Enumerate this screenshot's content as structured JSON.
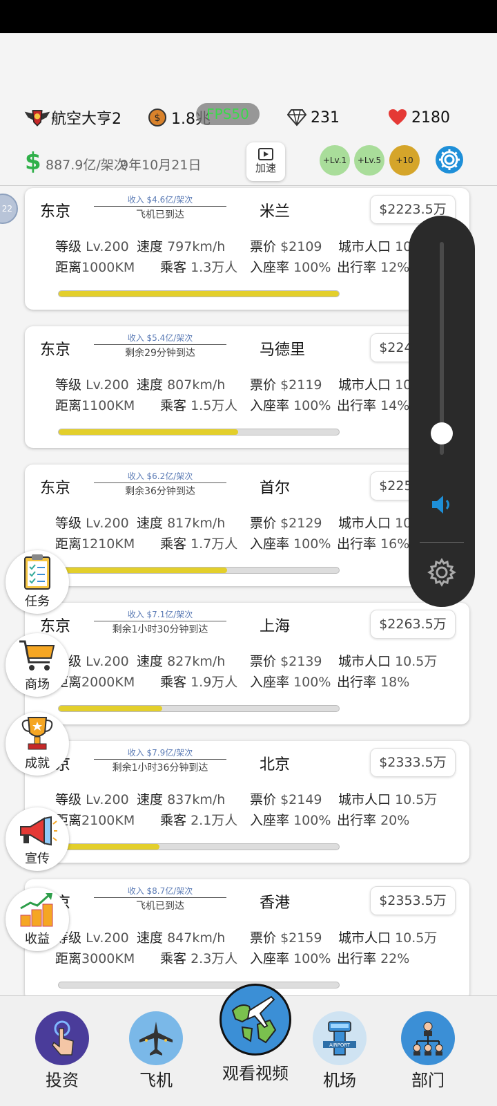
{
  "header": {
    "company": "航空大亨2",
    "coins": "1.8兆",
    "fps": "FPS50",
    "gems": "231",
    "hearts": "2180",
    "money_rate": "887.9亿/架次",
    "date": "9年10月21日",
    "speed_label": "加速",
    "lv1_label": "+Lv.1",
    "lv5_label": "+Lv.5",
    "plus10_label": "+10",
    "avatar_text": "22"
  },
  "labels": {
    "level": "等级",
    "speed": "速度",
    "distance": "距离",
    "passengers": "乘客",
    "ticket": "票价",
    "population": "城市人口",
    "occupancy": "入座率",
    "travel": "出行率"
  },
  "routes": [
    {
      "from": "东京",
      "to": "米兰",
      "income": "收入 $4.6亿/架次",
      "status": "飞机已到达",
      "price": "$2223.5万",
      "level": "Lv.200",
      "speed": "797km/h",
      "distance": "1000KM",
      "passengers": "1.3万人",
      "ticket": "$2109",
      "population": "10.5万",
      "occupancy": "100%",
      "travel": "12%",
      "progress": 1.0
    },
    {
      "from": "东京",
      "to": "马德里",
      "income": "收入 $5.4亿/架次",
      "status": "剩余29分钟到达",
      "price": "$2243.5万",
      "level": "Lv.200",
      "speed": "807km/h",
      "distance": "1100KM",
      "passengers": "1.5万人",
      "ticket": "$2119",
      "population": "10.5万",
      "occupancy": "100%",
      "travel": "14%",
      "progress": 0.64
    },
    {
      "from": "东京",
      "to": "首尔",
      "income": "收入 $6.2亿/架次",
      "status": "剩余36分钟到达",
      "price": "$2253.5万",
      "level": "Lv.200",
      "speed": "817km/h",
      "distance": "1210KM",
      "passengers": "1.7万人",
      "ticket": "$2129",
      "population": "10.5万",
      "occupancy": "100%",
      "travel": "16%",
      "progress": 0.6
    },
    {
      "from": "东京",
      "to": "上海",
      "income": "收入 $7.1亿/架次",
      "status": "剩余1小时30分钟到达",
      "price": "$2263.5万",
      "level": "Lv.200",
      "speed": "827km/h",
      "distance": "2000KM",
      "passengers": "1.9万人",
      "ticket": "$2139",
      "population": "10.5万",
      "occupancy": "100%",
      "travel": "18%",
      "progress": 0.37
    },
    {
      "from": "东京",
      "to": "北京",
      "income": "收入 $7.9亿/架次",
      "status": "剩余1小时36分钟到达",
      "price": "$2333.5万",
      "level": "Lv.200",
      "speed": "837km/h",
      "distance": "2100KM",
      "passengers": "2.1万人",
      "ticket": "$2149",
      "population": "10.5万",
      "occupancy": "100%",
      "travel": "20%",
      "progress": 0.36
    },
    {
      "from": "东京",
      "to": "香港",
      "income": "收入 $8.7亿/架次",
      "status": "飞机已到达",
      "price": "$2353.5万",
      "level": "Lv.200",
      "speed": "847km/h",
      "distance": "3000KM",
      "passengers": "2.3万人",
      "ticket": "$2159",
      "population": "10.5万",
      "occupancy": "100%",
      "travel": "22%",
      "progress": 0.0
    }
  ],
  "side_buttons": [
    {
      "label": "任务",
      "icon": "clipboard-icon"
    },
    {
      "label": "商场",
      "icon": "shopping-cart-icon"
    },
    {
      "label": "成就",
      "icon": "trophy-icon"
    },
    {
      "label": "宣传",
      "icon": "megaphone-icon"
    },
    {
      "label": "收益",
      "icon": "coins-chart-icon"
    }
  ],
  "volume": {
    "level": 0.1
  },
  "nav": {
    "invest": "投资",
    "planes": "飞机",
    "watch_video": "观看视频",
    "airport": "机场",
    "department": "部门"
  },
  "colors": {
    "progress_fill": "#e3cf2b",
    "money_green": "#30b04a",
    "fps_green": "#3ad94a",
    "income_blue": "#5b7bb5",
    "gear_blue": "#1e8fd8"
  }
}
